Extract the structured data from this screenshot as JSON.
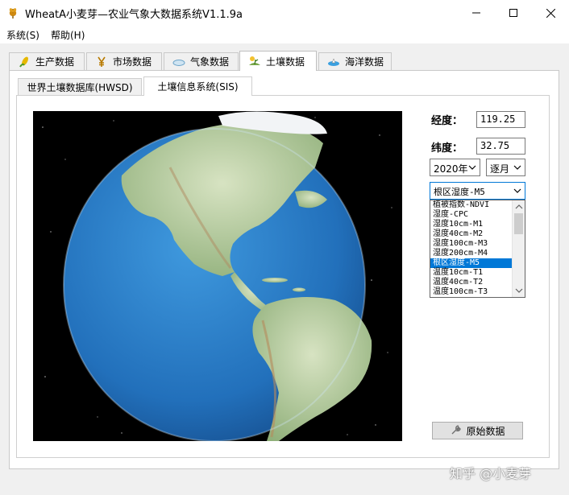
{
  "window": {
    "title": "WheatA小麦芽—农业气象大数据系统V1.1.9a",
    "app_icon": "wheat-icon",
    "buttons": [
      "minimize-icon",
      "maximize-icon",
      "close-icon"
    ]
  },
  "menu": {
    "items": [
      {
        "label": "系统(S)"
      },
      {
        "label": "帮助(H)"
      }
    ]
  },
  "tabs": [
    {
      "label": "生产数据",
      "icon": "corn-icon"
    },
    {
      "label": "市场数据",
      "icon": "yen-icon"
    },
    {
      "label": "气象数据",
      "icon": "cloud-icon"
    },
    {
      "label": "土壤数据",
      "icon": "soil-icon",
      "active": true
    },
    {
      "label": "海洋数据",
      "icon": "ocean-icon"
    }
  ],
  "subtabs": [
    {
      "label": "世界土壤数据库(HWSD)"
    },
    {
      "label": "土壤信息系统(SIS)",
      "active": true
    }
  ],
  "form": {
    "longitude_label": "经度：",
    "longitude_value": "119.25",
    "latitude_label": "纬度：",
    "latitude_value": "32.75",
    "year_select": "2020年",
    "period_select": "逐月",
    "variable_select": "根区湿度-M5",
    "variable_options": [
      "植被指数-NDVI",
      "湿度-CPC",
      "湿度10cm-M1",
      "湿度40cm-M2",
      "湿度100cm-M3",
      "湿度200cm-M4",
      "根区湿度-M5",
      "温度10cm-T1",
      "温度40cm-T2",
      "温度100cm-T3"
    ],
    "selected_index": 6,
    "raw_data_button": "原始数据"
  },
  "watermark": "知乎 @小麦芽",
  "colors": {
    "accent": "#0078d7",
    "ocean": "#2b7fc9",
    "land": "#b9cfa0"
  }
}
